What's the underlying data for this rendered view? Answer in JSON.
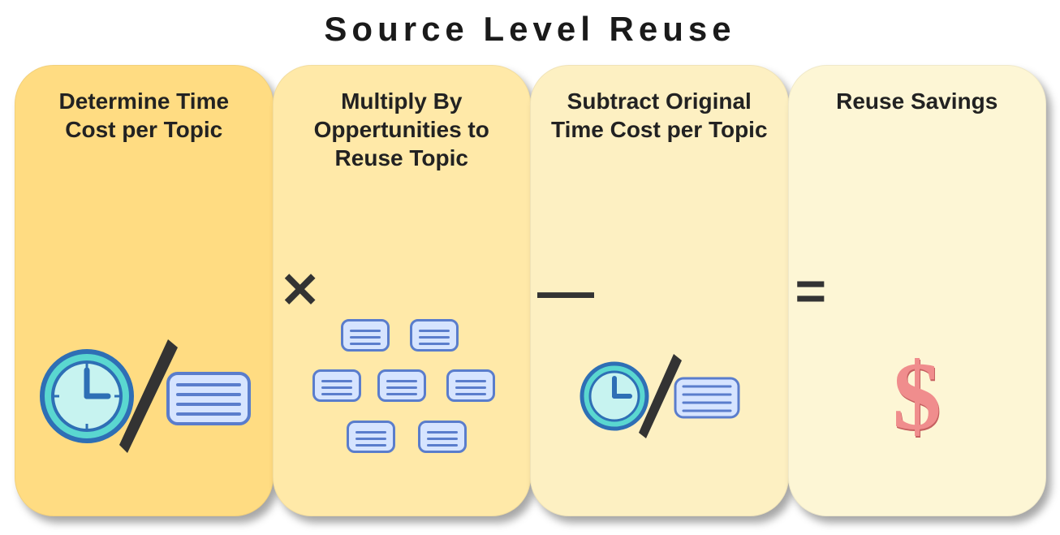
{
  "title": "Source Level Reuse",
  "cards": [
    {
      "label": "Determine Time Cost per Topic"
    },
    {
      "label": "Multiply By Oppertunities to Reuse Topic"
    },
    {
      "label": "Subtract Original Time Cost per Topic"
    },
    {
      "label": "Reuse Savings"
    }
  ],
  "operators": {
    "multiply": "✕",
    "minus": "—",
    "equals": "="
  },
  "dollar": "$"
}
